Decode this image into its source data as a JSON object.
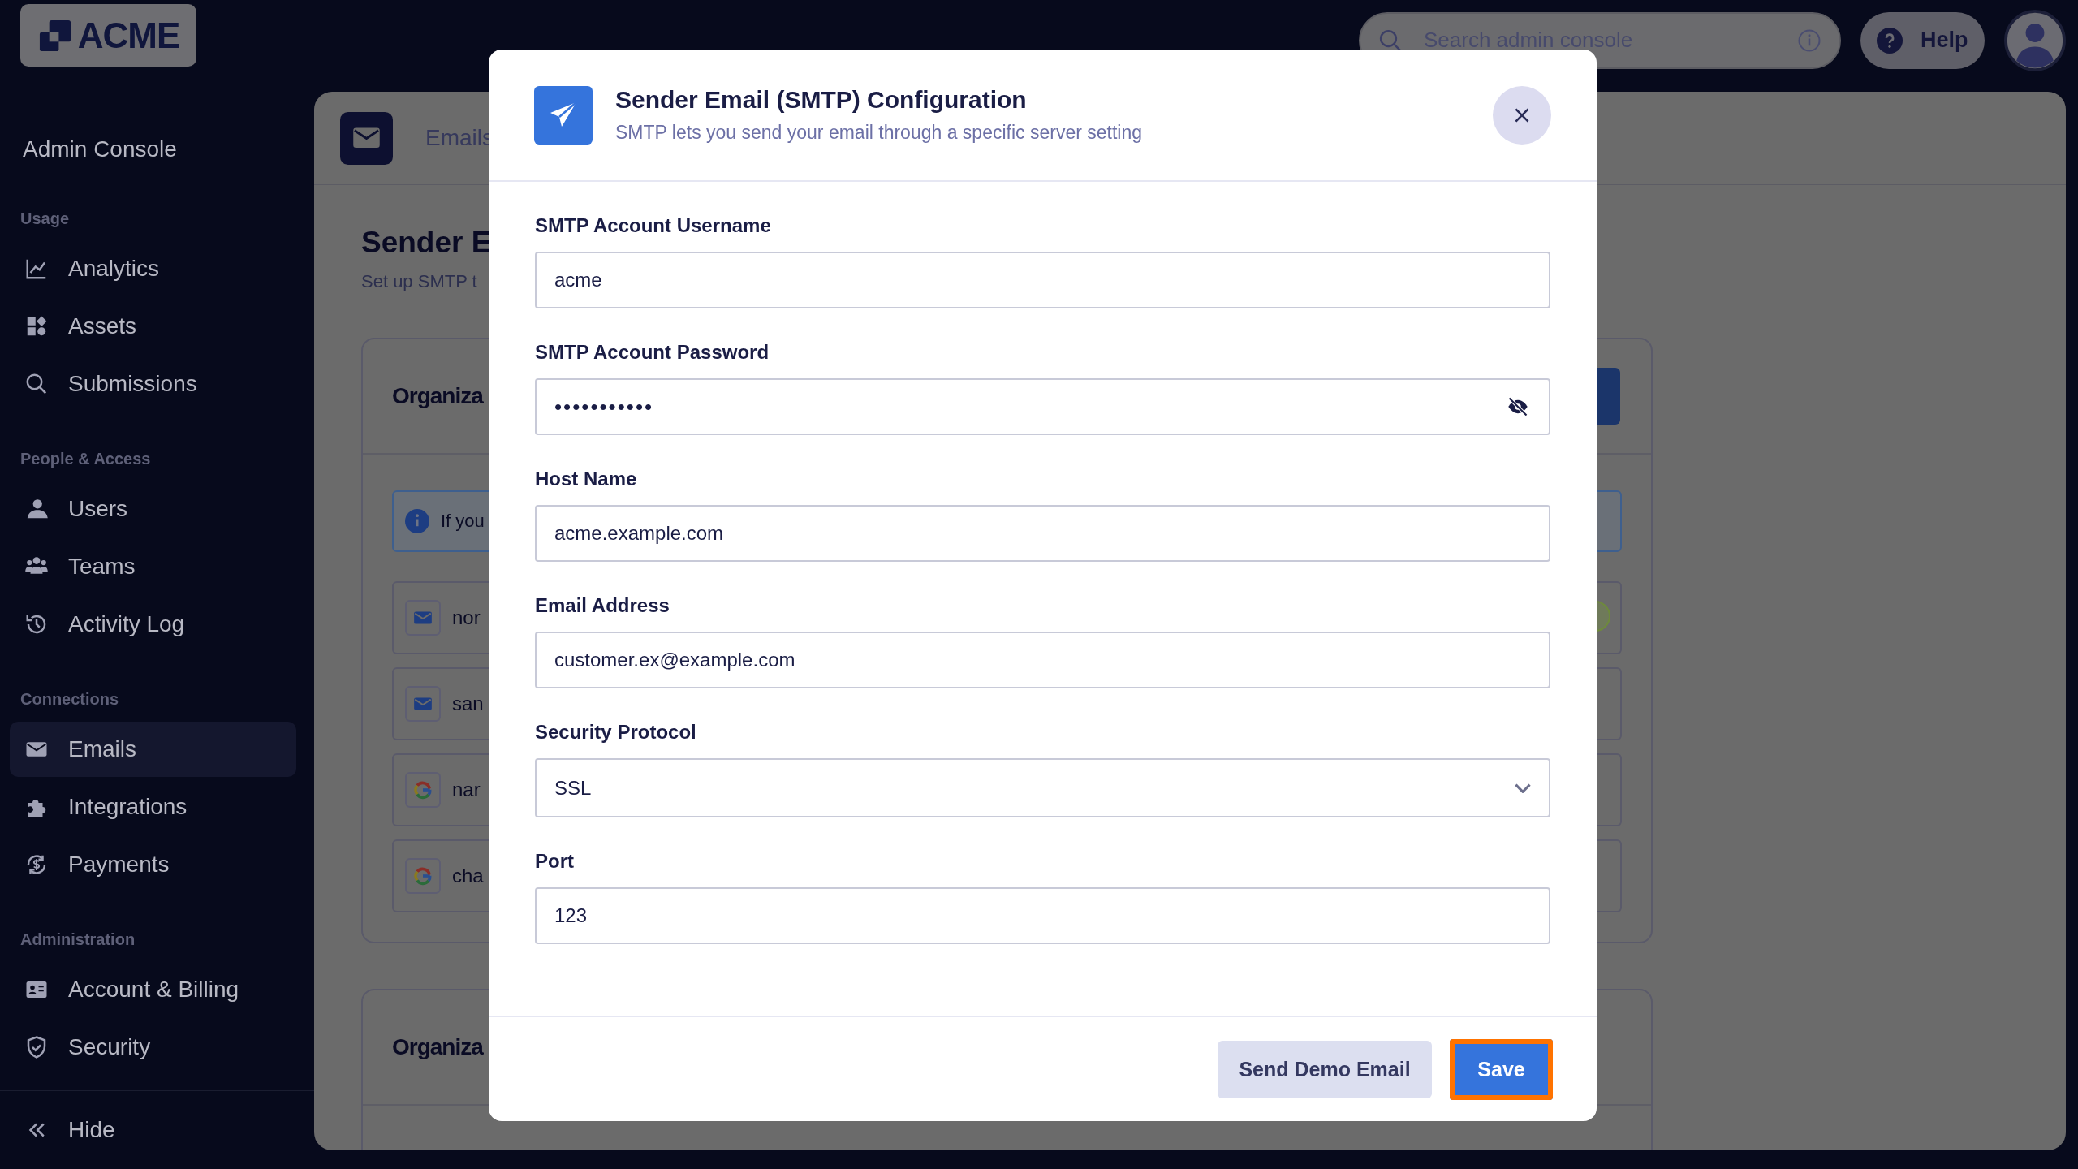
{
  "logo": {
    "text": "ACME"
  },
  "sidebar": {
    "title": "Admin Console",
    "sections": [
      {
        "heading": "Usage",
        "items": [
          {
            "label": "Analytics",
            "selected": false
          },
          {
            "label": "Assets",
            "selected": false
          },
          {
            "label": "Submissions",
            "selected": false
          }
        ]
      },
      {
        "heading": "People & Access",
        "items": [
          {
            "label": "Users",
            "selected": false
          },
          {
            "label": "Teams",
            "selected": false
          },
          {
            "label": "Activity Log",
            "selected": false
          }
        ]
      },
      {
        "heading": "Connections",
        "items": [
          {
            "label": "Emails",
            "selected": true
          },
          {
            "label": "Integrations",
            "selected": false
          },
          {
            "label": "Payments",
            "selected": false
          }
        ]
      },
      {
        "heading": "Administration",
        "items": [
          {
            "label": "Account & Billing",
            "selected": false
          },
          {
            "label": "Security",
            "selected": false
          }
        ]
      }
    ],
    "collapse": {
      "label": "Hide"
    }
  },
  "top_bar": {
    "search": {
      "placeholder": "Search admin console"
    },
    "help": {
      "label": "Help"
    }
  },
  "page": {
    "breadcrumb": "Emails",
    "title": "Sender E",
    "subtitle": "Set up SMTP t",
    "cards": [
      {
        "title": "Organiza",
        "info": "If you",
        "accounts": [
          {
            "text": "nor",
            "kind": "smtp",
            "active": true
          },
          {
            "text": "san",
            "kind": "smtp",
            "active": false
          },
          {
            "text": "nar",
            "kind": "google",
            "active": false
          },
          {
            "text": "cha",
            "kind": "google",
            "active": false
          }
        ]
      },
      {
        "title": "Organiza"
      }
    ]
  },
  "dialog": {
    "title": "Sender Email (SMTP) Configuration",
    "subtitle": "SMTP lets you send your email through a specific server setting",
    "fields": [
      {
        "label": "SMTP Account Username",
        "kind": "text",
        "value": "acme"
      },
      {
        "label": "SMTP Account Password",
        "kind": "password",
        "value": "•••••••••••"
      },
      {
        "label": "Host Name",
        "kind": "text",
        "value": "acme.example.com"
      },
      {
        "label": "Email Address",
        "kind": "text",
        "value": "customer.ex@example.com"
      },
      {
        "label": "Security Protocol",
        "kind": "select",
        "value": "SSL"
      },
      {
        "label": "Port",
        "kind": "text",
        "value": "123"
      }
    ],
    "buttons": [
      {
        "label": "Send Demo Email",
        "kind": "secondary",
        "highlighted": false
      },
      {
        "label": "Save",
        "kind": "primary",
        "highlighted": true
      }
    ]
  }
}
